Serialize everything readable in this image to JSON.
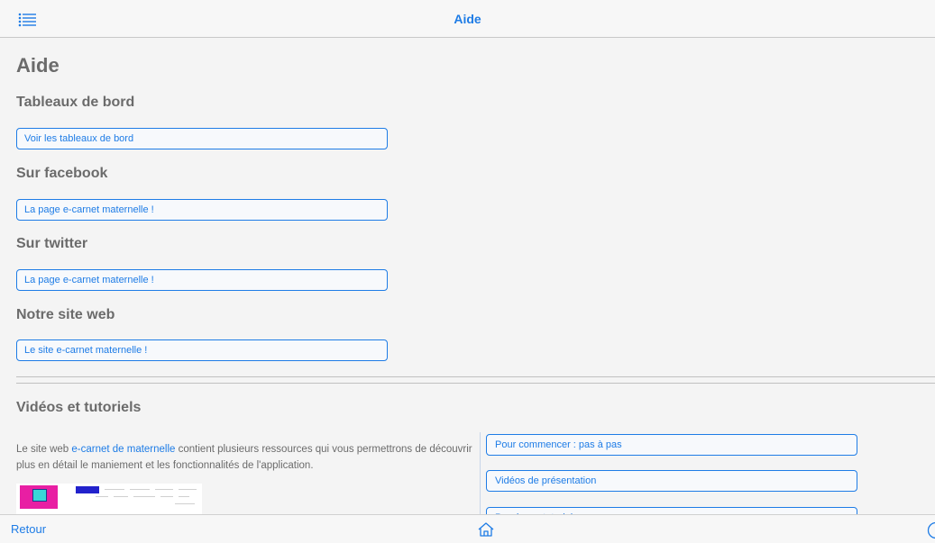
{
  "header": {
    "title": "Aide",
    "menu_icon": "list-icon"
  },
  "page": {
    "title": "Aide"
  },
  "sections": [
    {
      "title": "Tableaux de bord",
      "link": "Voir les tableaux de bord"
    },
    {
      "title": "Sur facebook",
      "link": "La page e-carnet maternelle !"
    },
    {
      "title": "Sur twitter",
      "link": "La page e-carnet maternelle !"
    },
    {
      "title": "Notre site web",
      "link": "Le site e-carnet maternelle !"
    }
  ],
  "videos": {
    "title": "Vidéos et tutoriels",
    "desc_before": "Le site web ",
    "desc_link": "e-carnet de maternelle",
    "desc_after": " contient plusieurs ressources qui vous permettrons de découvrir plus en détail le maniement et les fonctionnalités de l'application.",
    "buttons": [
      "Pour commencer : pas à pas",
      "Vidéos de présentation",
      "Pas-à-pas tutoriels"
    ]
  },
  "footer": {
    "back_label": "Retour",
    "home_icon": "home-icon",
    "help_icon": "help-icon"
  },
  "colors": {
    "accent": "#1e7ce6",
    "text": "#6b6b6b",
    "background": "#f4f4f4"
  }
}
